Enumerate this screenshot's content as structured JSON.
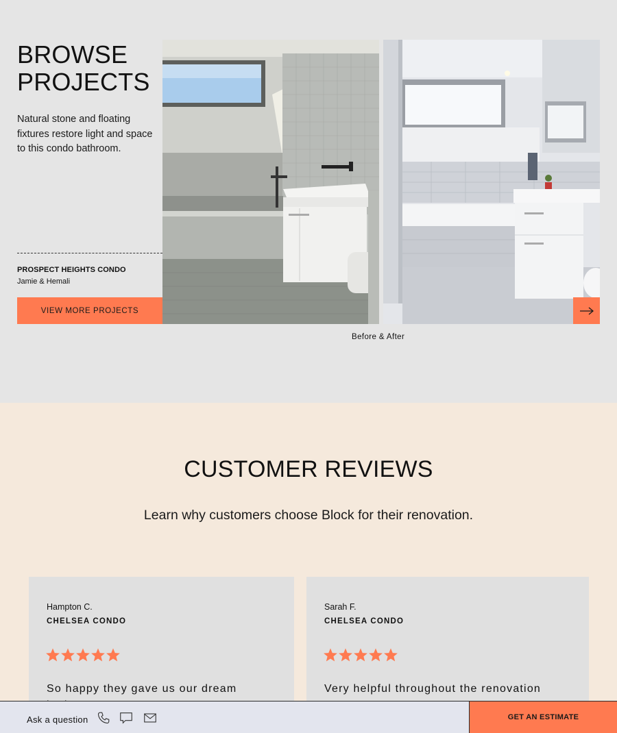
{
  "browse": {
    "title_line1": "BROWSE",
    "title_line2": "PROJECTS",
    "description": "Natural stone and floating fixtures restore light and space to this condo bathroom.",
    "project_name": "PROSPECT HEIGHTS CONDO",
    "project_client": "Jamie & Hemali",
    "view_more_label": "VIEW MORE PROJECTS",
    "next_icon": "arrow-right-icon",
    "photo_caption": "Before & After"
  },
  "reviews": {
    "title": "CUSTOMER REVIEWS",
    "subtitle": "Learn why customers choose Block for their renovation.",
    "cards": [
      {
        "name": "Hampton C.",
        "project": "CHELSEA CONDO",
        "rating": 5,
        "quote": "So happy they gave us our dream bathroom"
      },
      {
        "name": "Sarah F.",
        "project": "CHELSEA CONDO",
        "rating": 5,
        "quote": "Very helpful throughout the renovation"
      }
    ]
  },
  "bottom_bar": {
    "ask_label": "Ask a question",
    "icons": [
      "phone-icon",
      "chat-icon",
      "mail-icon"
    ],
    "estimate_label": "GET AN ESTIMATE"
  },
  "colors": {
    "accent": "#ff7a50",
    "page_bg": "#e5e5e5",
    "reviews_bg": "#f5e9dc",
    "card_bg": "#e0e0e0",
    "bar_bg": "#e3e5ee"
  }
}
